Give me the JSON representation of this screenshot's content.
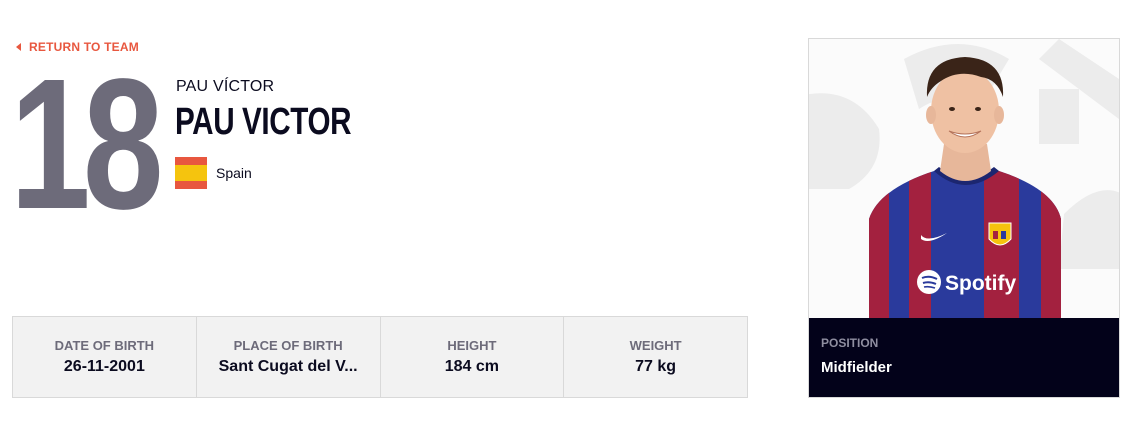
{
  "nav": {
    "back_label": "RETURN TO TEAM"
  },
  "player": {
    "number": "18",
    "nickname": "PAU VÍCTOR",
    "full_name": "PAU VICTOR",
    "nationality": "Spain"
  },
  "stats": [
    {
      "label": "DATE OF BIRTH",
      "value": "26-11-2001"
    },
    {
      "label": "PLACE OF BIRTH",
      "value": "Sant Cugat del V..."
    },
    {
      "label": "HEIGHT",
      "value": "184 cm"
    },
    {
      "label": "WEIGHT",
      "value": "77 kg"
    }
  ],
  "card": {
    "position_label": "POSITION",
    "position_value": "Midfielder",
    "shirt_sponsor": "Spotify"
  },
  "colors": {
    "accent": "#e8573f",
    "number_gray": "#6d6b7a",
    "dark": "#03021a",
    "stats_bg": "#f2f2f2",
    "jersey_blue": "#2a3a9c",
    "jersey_red": "#a3213f"
  },
  "icons": [
    "back-arrow-icon",
    "spain-flag-icon",
    "nike-swoosh-icon",
    "club-crest-icon",
    "spotify-logo-icon"
  ]
}
